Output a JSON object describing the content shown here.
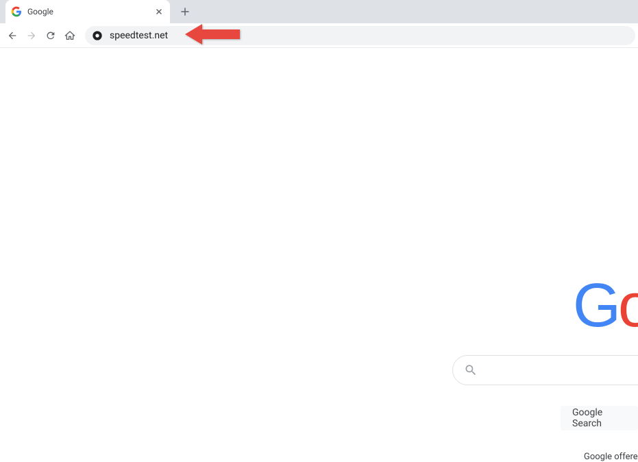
{
  "tab": {
    "title": "Google"
  },
  "address_bar": {
    "url": "speedtest.net"
  },
  "content": {
    "logo_letters": [
      "G",
      "o"
    ],
    "search_button_label": "Google Search",
    "offered_text": "Google offere"
  }
}
